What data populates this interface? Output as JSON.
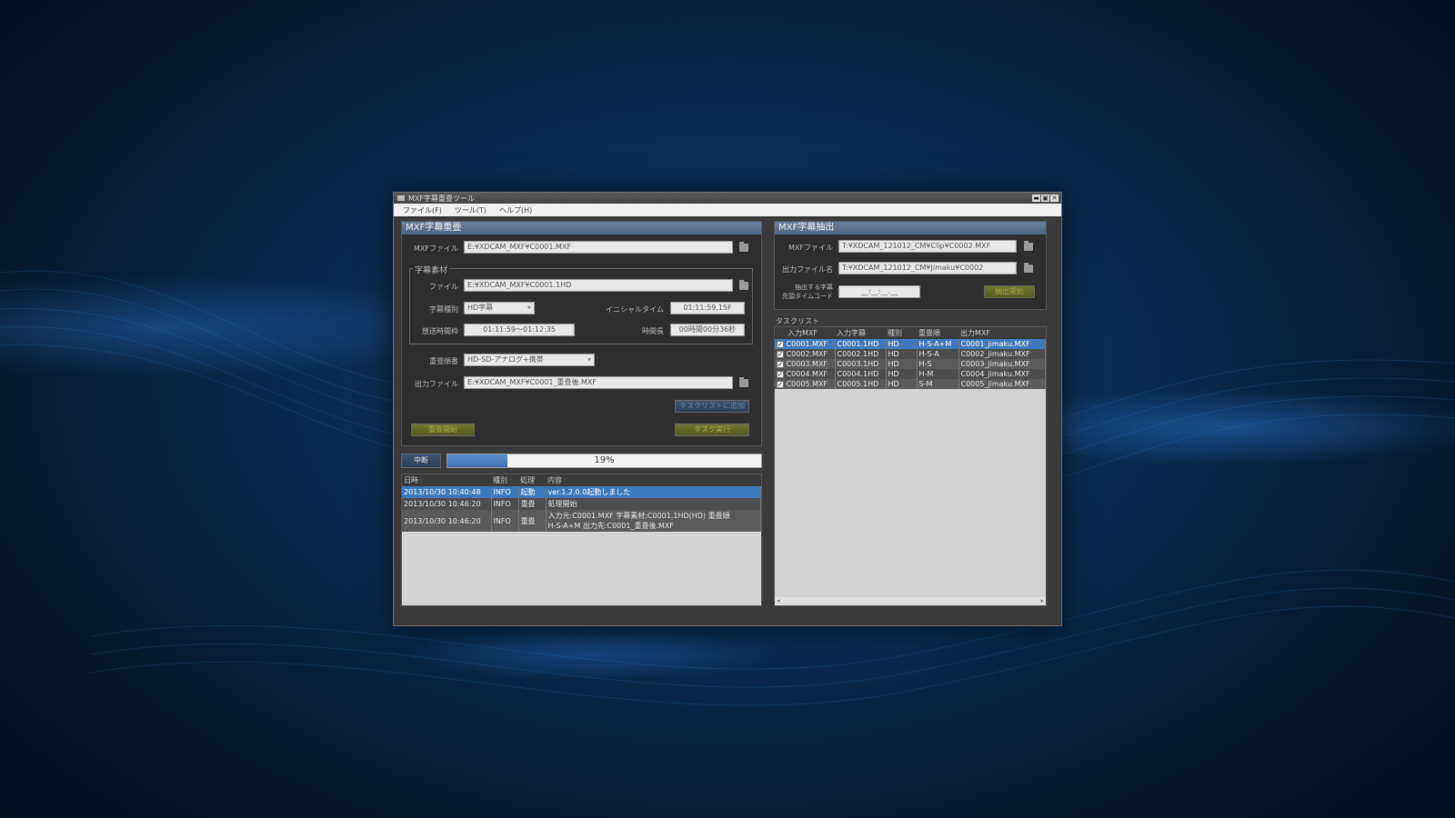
{
  "window": {
    "title": "MXF字幕重畳ツール",
    "controls": [
      "▬",
      "▣",
      "✕"
    ]
  },
  "menu": [
    "ファイル(F)",
    "ツール(T)",
    "ヘルプ(H)"
  ],
  "overlay_panel": {
    "header": "MXF字幕重畳",
    "mxf_file_label": "MXFファイル",
    "mxf_file_value": "E:¥XDCAM_MXF¥C0001.MXF",
    "group_title": "字幕素材",
    "file_label": "ファイル",
    "file_value": "E:¥XDCAM_MXF¥C0001.1HD",
    "subtitle_type_label": "字幕種別",
    "subtitle_type_value": "HD字幕",
    "initial_time_label": "イニシャルタイム",
    "initial_time_value": "01:11:59.15F",
    "broadcast_time_label": "放送時間枠",
    "broadcast_time_value": "01:11:59〜01:12:35",
    "duration_label": "時間長",
    "duration_value": "00時間00分36秒",
    "priority_label": "重畳順番",
    "priority_value": "HD-SD-アナログ+携帯",
    "output_file_label": "出力ファイル",
    "output_file_value": "E:¥XDCAM_MXF¥C0001_重畳後.MXF",
    "btn_add_task": "タスクリストに追加",
    "btn_left": "重畳開始",
    "btn_run": "タスク実行"
  },
  "progress": {
    "cancel_label": "中断",
    "percent": 19,
    "percent_label": "19%"
  },
  "log": {
    "headers": [
      "日時",
      "種別",
      "処理",
      "内容"
    ],
    "rows": [
      {
        "time": "2013/10/30 10:40:48",
        "type": "INFO",
        "proc": "起動",
        "content": "ver.1.2.0.0起動しました"
      },
      {
        "time": "2013/10/30 10:46:20",
        "type": "INFO",
        "proc": "重畳",
        "content": "処理開始"
      },
      {
        "time": "2013/10/30 10:46:20",
        "type": "INFO",
        "proc": "重畳",
        "content": "入力元:C0001.MXF 字幕素材:C0001.1HD(HD) 重畳順",
        "content2": "H-S-A+M 出力先:C0001_重畳後.MXF"
      }
    ]
  },
  "extract_panel": {
    "header": "MXF字幕抽出",
    "mxf_file_label": "MXFファイル",
    "mxf_file_value": "T:¥XDCAM_121012_CM¥Clip¥C0002.MXF",
    "output_name_label": "出力ファイル名",
    "output_name_value": "T:¥XDCAM_121012_CM¥Jimaku¥C0002",
    "timecode_label_1": "抽出する字幕",
    "timecode_label_2": "先頭タイムコード",
    "timecode_value": "__:__:__.__",
    "btn_extract": "抽出開始"
  },
  "task_list": {
    "title": "タスクリスト",
    "headers": [
      "入力MXF",
      "入力字幕",
      "種別",
      "重畳順",
      "出力MXF"
    ],
    "rows": [
      {
        "in": "C0001.MXF",
        "sub": "C0001.1HD",
        "type": "HD",
        "order": "H-S-A+M",
        "out": "C0001_jimaku.MXF"
      },
      {
        "in": "C0002.MXF",
        "sub": "C0002.1HD",
        "type": "HD",
        "order": "H-S-A",
        "out": "C0002_jimaku.MXF"
      },
      {
        "in": "C0003.MXF",
        "sub": "C0003.1HD",
        "type": "HD",
        "order": "H-S",
        "out": "C0003_jimaku.MXF"
      },
      {
        "in": "C0004.MXF",
        "sub": "C0004.1HD",
        "type": "HD",
        "order": "H-M",
        "out": "C0004_jimaku.MXF"
      },
      {
        "in": "C0005.MXF",
        "sub": "C0005.1HD",
        "type": "HD",
        "order": "S-M",
        "out": "C0005_jimaku.MXF"
      }
    ],
    "check_mark": "✓",
    "scroll_left": "◂",
    "scroll_right": "▸"
  },
  "colors": {
    "accent_blue": "#3d79bd",
    "header_blue": "#5b7290",
    "olive_button": "#626a2a"
  }
}
